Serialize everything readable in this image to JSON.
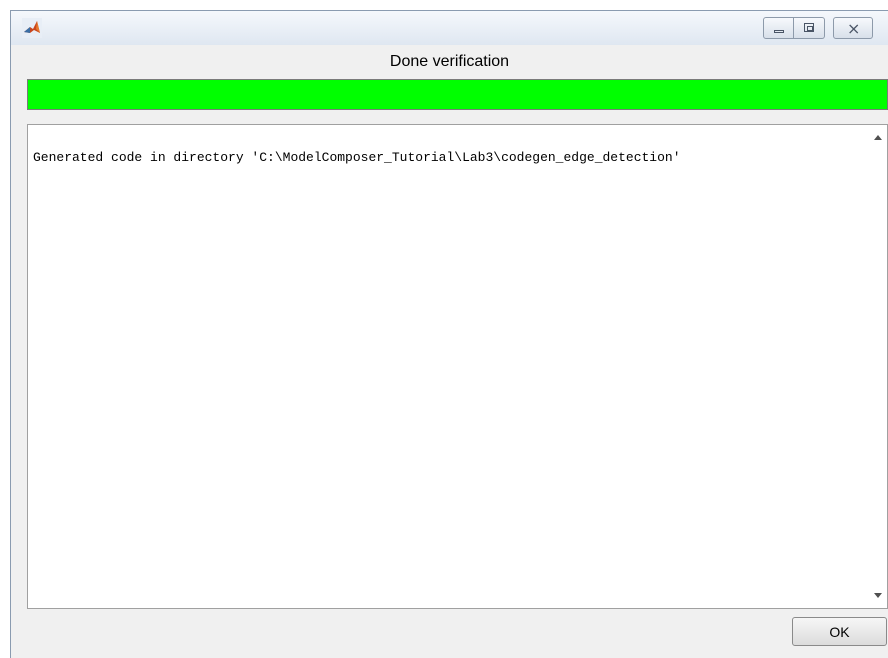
{
  "window": {
    "app_icon": "matlab-logo-icon",
    "controls": {
      "minimize_icon": "minimize-icon",
      "maximize_icon": "maximize-icon",
      "close_icon": "close-icon",
      "close_glyph": "⨯"
    }
  },
  "status": {
    "title": "Done verification",
    "progress_fraction": 1.0,
    "progress_color": "#00ff00"
  },
  "output": {
    "text": "Generated code in directory 'C:\\ModelComposer_Tutorial\\Lab3\\codegen_edge_detection'"
  },
  "footer": {
    "ok_label": "OK"
  }
}
